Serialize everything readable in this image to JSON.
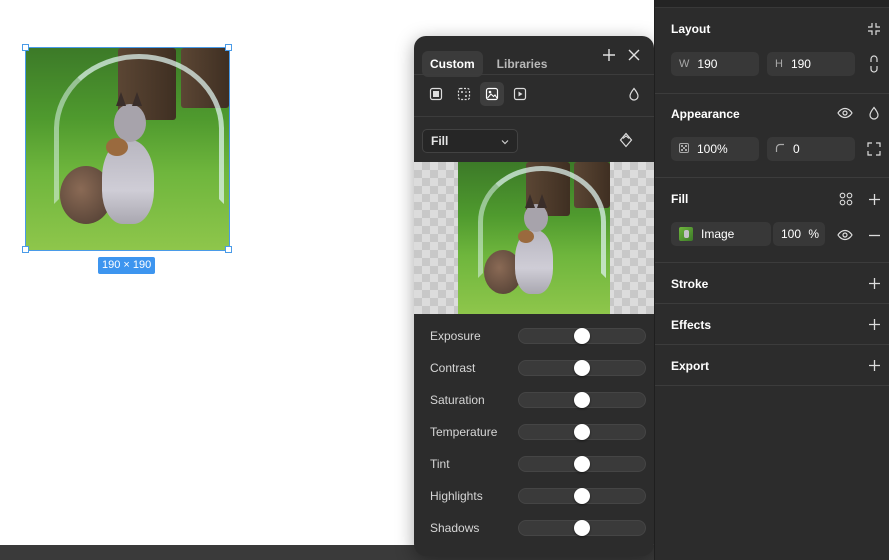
{
  "canvas": {
    "selection_size": "190 × 190"
  },
  "color_popup": {
    "tabs": [
      "Custom",
      "Libraries"
    ],
    "active_tab": "Custom",
    "fill_mode": "Fill",
    "sliders": [
      {
        "label": "Exposure",
        "value": 0.5
      },
      {
        "label": "Contrast",
        "value": 0.5
      },
      {
        "label": "Saturation",
        "value": 0.5
      },
      {
        "label": "Temperature",
        "value": 0.5
      },
      {
        "label": "Tint",
        "value": 0.5
      },
      {
        "label": "Highlights",
        "value": 0.5
      },
      {
        "label": "Shadows",
        "value": 0.5
      }
    ]
  },
  "props": {
    "layout": {
      "title": "Layout",
      "w_label": "W",
      "w_value": "190",
      "h_label": "H",
      "h_value": "190"
    },
    "appearance": {
      "title": "Appearance",
      "opacity": "100%",
      "radius": "0"
    },
    "fill": {
      "title": "Fill",
      "layer_name": "Image",
      "layer_opacity": "100",
      "percent_sign": "%"
    },
    "stroke": {
      "title": "Stroke"
    },
    "effects": {
      "title": "Effects"
    },
    "export": {
      "title": "Export"
    }
  },
  "colors": {
    "selection": "#4a9be8",
    "badge": "#3d95ef",
    "panel_bg": "#2c2c2c"
  }
}
